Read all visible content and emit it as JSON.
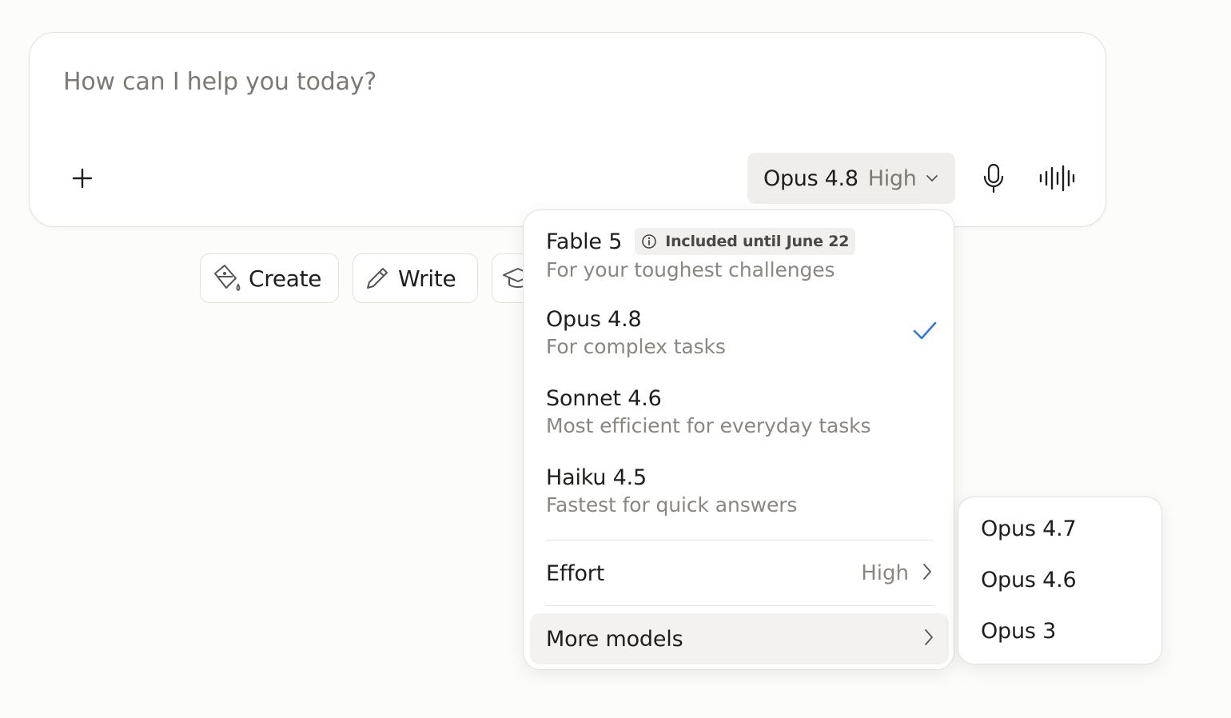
{
  "composer": {
    "placeholder": "How can I help you today?",
    "model_selector": {
      "model": "Opus 4.8",
      "effort": "High"
    }
  },
  "chips": [
    {
      "label": "Create",
      "icon": "paint-bucket-icon"
    },
    {
      "label": "Write",
      "icon": "pencil-icon"
    },
    {
      "label": "",
      "icon": "graduation-cap-icon"
    }
  ],
  "dropdown": {
    "models": [
      {
        "name": "Fable 5",
        "badge": "Included until June 22",
        "description": "For your toughest challenges",
        "selected": false
      },
      {
        "name": "Opus 4.8",
        "badge": "",
        "description": "For complex tasks",
        "selected": true
      },
      {
        "name": "Sonnet 4.6",
        "badge": "",
        "description": "Most efficient for everyday tasks",
        "selected": false
      },
      {
        "name": "Haiku 4.5",
        "badge": "",
        "description": "Fastest for quick answers",
        "selected": false
      }
    ],
    "effort": {
      "label": "Effort",
      "value": "High"
    },
    "more_models": {
      "label": "More models"
    }
  },
  "submenu": {
    "items": [
      "Opus 4.7",
      "Opus 4.6",
      "Opus 3"
    ]
  },
  "colors": {
    "accent_check": "#2c7be5",
    "text": "#1f1e1d",
    "muted": "#8a8782"
  }
}
